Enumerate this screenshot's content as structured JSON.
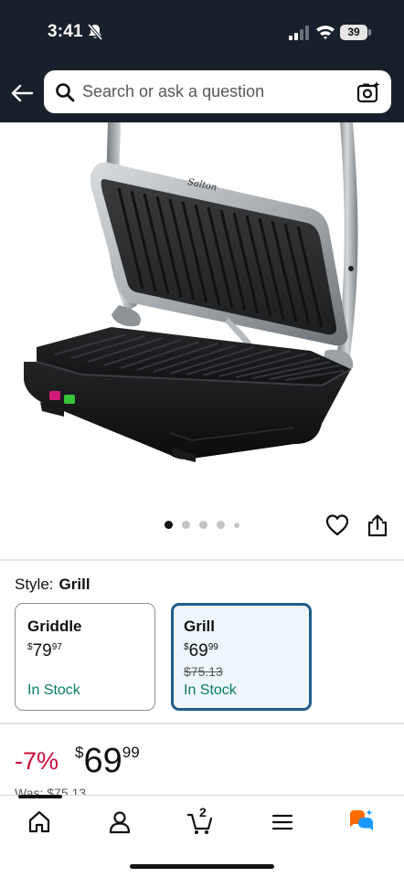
{
  "status_bar": {
    "time": "3:41",
    "battery_level": "39"
  },
  "search": {
    "placeholder": "Search or ask a question"
  },
  "product_image": {
    "brand_text": "Salton",
    "carousel_count": 5,
    "active_index": 0
  },
  "style": {
    "label": "Style:",
    "selected_value": "Grill",
    "options": [
      {
        "name": "Griddle",
        "price_dollars": "79",
        "price_cents": "97",
        "was_price": "",
        "stock": "In Stock",
        "selected": false
      },
      {
        "name": "Grill",
        "price_dollars": "69",
        "price_cents": "99",
        "was_price": "$75.13",
        "stock": "In Stock",
        "selected": true
      }
    ]
  },
  "pricing": {
    "discount": "-7%",
    "currency": "$",
    "dollars": "69",
    "cents": "99",
    "was_text": "Was: $75.13"
  },
  "bottom_nav": {
    "items": [
      "home",
      "account",
      "cart",
      "menu",
      "rufus-ai"
    ],
    "cart_count": "2"
  },
  "colors": {
    "header_bg": "#18212b",
    "selected_border": "#1f5c8a",
    "stock_green": "#067d62",
    "discount_red": "#cc0c39",
    "rufus_orange": "#ff6a00",
    "rufus_blue": "#1a98ff"
  }
}
